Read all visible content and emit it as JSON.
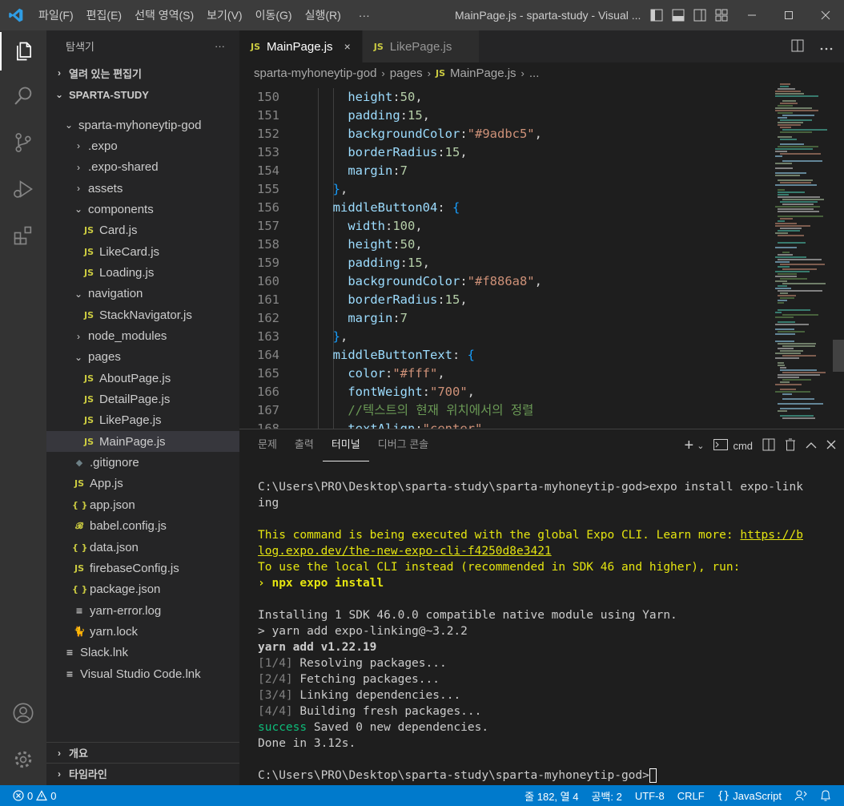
{
  "titlebar": {
    "menu": [
      "파일(F)",
      "편집(E)",
      "선택 영역(S)",
      "보기(V)",
      "이동(G)",
      "실행(R)",
      "···"
    ],
    "title": "MainPage.js - sparta-study - Visual ..."
  },
  "sidebar": {
    "header": "탐색기",
    "more": "···",
    "open_editors": "열려 있는 편집기",
    "workspace": "SPARTA-STUDY",
    "tree": [
      {
        "label": "sparta-myhoneytip-god",
        "type": "folder-open",
        "depth": 1
      },
      {
        "label": ".expo",
        "type": "folder",
        "depth": 2
      },
      {
        "label": ".expo-shared",
        "type": "folder",
        "depth": 2
      },
      {
        "label": "assets",
        "type": "folder",
        "depth": 2
      },
      {
        "label": "components",
        "type": "folder-open",
        "depth": 2
      },
      {
        "label": "Card.js",
        "type": "js",
        "depth": 3
      },
      {
        "label": "LikeCard.js",
        "type": "js",
        "depth": 3
      },
      {
        "label": "Loading.js",
        "type": "js",
        "depth": 3
      },
      {
        "label": "navigation",
        "type": "folder-open",
        "depth": 2
      },
      {
        "label": "StackNavigator.js",
        "type": "js",
        "depth": 3
      },
      {
        "label": "node_modules",
        "type": "folder",
        "depth": 2
      },
      {
        "label": "pages",
        "type": "folder-open",
        "depth": 2
      },
      {
        "label": "AboutPage.js",
        "type": "js",
        "depth": 3
      },
      {
        "label": "DetailPage.js",
        "type": "js",
        "depth": 3
      },
      {
        "label": "LikePage.js",
        "type": "js",
        "depth": 3
      },
      {
        "label": "MainPage.js",
        "type": "js",
        "depth": 3,
        "selected": true
      },
      {
        "label": ".gitignore",
        "type": "git",
        "depth": 2
      },
      {
        "label": "App.js",
        "type": "js",
        "depth": 2
      },
      {
        "label": "app.json",
        "type": "json",
        "depth": 2
      },
      {
        "label": "babel.config.js",
        "type": "babel",
        "depth": 2
      },
      {
        "label": "data.json",
        "type": "json",
        "depth": 2
      },
      {
        "label": "firebaseConfig.js",
        "type": "js",
        "depth": 2
      },
      {
        "label": "package.json",
        "type": "json",
        "depth": 2
      },
      {
        "label": "yarn-error.log",
        "type": "log",
        "depth": 2
      },
      {
        "label": "yarn.lock",
        "type": "yarn",
        "depth": 2
      },
      {
        "label": "Slack.lnk",
        "type": "lnk",
        "depth": 1
      },
      {
        "label": "Visual Studio Code.lnk",
        "type": "lnk",
        "depth": 1
      }
    ],
    "outline": "개요",
    "timeline": "타임라인"
  },
  "tabs": [
    {
      "label": "MainPage.js",
      "active": true,
      "badge": "JS",
      "close": "×"
    },
    {
      "label": "LikePage.js",
      "active": false,
      "badge": "JS"
    }
  ],
  "breadcrumb": {
    "parts": [
      "sparta-myhoneytip-god",
      "pages",
      "MainPage.js",
      "..."
    ],
    "badge": "JS"
  },
  "code": [
    {
      "n": "150",
      "indent": 2,
      "tokens": [
        [
          "prop",
          "height"
        ],
        [
          "pun",
          ":"
        ],
        [
          "num",
          "50"
        ],
        [
          "pun",
          ","
        ]
      ]
    },
    {
      "n": "151",
      "indent": 2,
      "tokens": [
        [
          "prop",
          "padding"
        ],
        [
          "pun",
          ":"
        ],
        [
          "num",
          "15"
        ],
        [
          "pun",
          ","
        ]
      ]
    },
    {
      "n": "152",
      "indent": 2,
      "tokens": [
        [
          "prop",
          "backgroundColor"
        ],
        [
          "pun",
          ":"
        ],
        [
          "str",
          "\"#9adbc5\""
        ],
        [
          "pun",
          ","
        ]
      ]
    },
    {
      "n": "153",
      "indent": 2,
      "tokens": [
        [
          "prop",
          "borderRadius"
        ],
        [
          "pun",
          ":"
        ],
        [
          "num",
          "15"
        ],
        [
          "pun",
          ","
        ]
      ]
    },
    {
      "n": "154",
      "indent": 2,
      "tokens": [
        [
          "prop",
          "margin"
        ],
        [
          "pun",
          ":"
        ],
        [
          "num",
          "7"
        ]
      ]
    },
    {
      "n": "155",
      "indent": 1,
      "tokens": [
        [
          "brace",
          "}"
        ],
        [
          "pun",
          ","
        ]
      ]
    },
    {
      "n": "156",
      "indent": 1,
      "tokens": [
        [
          "prop",
          "middleButton04"
        ],
        [
          "pun",
          ": "
        ],
        [
          "brace",
          "{"
        ]
      ]
    },
    {
      "n": "157",
      "indent": 2,
      "tokens": [
        [
          "prop",
          "width"
        ],
        [
          "pun",
          ":"
        ],
        [
          "num",
          "100"
        ],
        [
          "pun",
          ","
        ]
      ]
    },
    {
      "n": "158",
      "indent": 2,
      "tokens": [
        [
          "prop",
          "height"
        ],
        [
          "pun",
          ":"
        ],
        [
          "num",
          "50"
        ],
        [
          "pun",
          ","
        ]
      ]
    },
    {
      "n": "159",
      "indent": 2,
      "tokens": [
        [
          "prop",
          "padding"
        ],
        [
          "pun",
          ":"
        ],
        [
          "num",
          "15"
        ],
        [
          "pun",
          ","
        ]
      ]
    },
    {
      "n": "160",
      "indent": 2,
      "tokens": [
        [
          "prop",
          "backgroundColor"
        ],
        [
          "pun",
          ":"
        ],
        [
          "str",
          "\"#f886a8\""
        ],
        [
          "pun",
          ","
        ]
      ]
    },
    {
      "n": "161",
      "indent": 2,
      "tokens": [
        [
          "prop",
          "borderRadius"
        ],
        [
          "pun",
          ":"
        ],
        [
          "num",
          "15"
        ],
        [
          "pun",
          ","
        ]
      ]
    },
    {
      "n": "162",
      "indent": 2,
      "tokens": [
        [
          "prop",
          "margin"
        ],
        [
          "pun",
          ":"
        ],
        [
          "num",
          "7"
        ]
      ]
    },
    {
      "n": "163",
      "indent": 1,
      "tokens": [
        [
          "brace",
          "}"
        ],
        [
          "pun",
          ","
        ]
      ]
    },
    {
      "n": "164",
      "indent": 1,
      "tokens": [
        [
          "prop",
          "middleButtonText"
        ],
        [
          "pun",
          ": "
        ],
        [
          "brace",
          "{"
        ]
      ]
    },
    {
      "n": "165",
      "indent": 2,
      "tokens": [
        [
          "prop",
          "color"
        ],
        [
          "pun",
          ":"
        ],
        [
          "str",
          "\"#fff\""
        ],
        [
          "pun",
          ","
        ]
      ]
    },
    {
      "n": "166",
      "indent": 2,
      "tokens": [
        [
          "prop",
          "fontWeight"
        ],
        [
          "pun",
          ":"
        ],
        [
          "str",
          "\"700\""
        ],
        [
          "pun",
          ","
        ]
      ]
    },
    {
      "n": "167",
      "indent": 2,
      "tokens": [
        [
          "cmt",
          "//텍스트의 현재 위치에서의 정렬"
        ]
      ]
    },
    {
      "n": "168",
      "indent": 2,
      "tokens": [
        [
          "prop",
          "textAlign"
        ],
        [
          "pun",
          ":"
        ],
        [
          "str",
          "\"center\""
        ]
      ]
    }
  ],
  "panel": {
    "tabs": [
      "문제",
      "출력",
      "터미널",
      "디버그 콘솔"
    ],
    "active_tab": "터미널",
    "shell": "cmd",
    "terminal": [
      {
        "cls": "",
        "text": "C:\\Users\\PRO\\Desktop\\sparta-study\\sparta-myhoneytip-god>expo install expo-link"
      },
      {
        "cls": "",
        "text": "ing"
      },
      {
        "cls": "",
        "text": ""
      },
      {
        "cls": "yellow",
        "text": "This command is being executed with the global Expo CLI. Learn more: ",
        "link": "https://b"
      },
      {
        "cls": "yellow ul",
        "text": "log.expo.dev/the-new-expo-cli-f4250d8e3421"
      },
      {
        "cls": "yellow",
        "text": "To use the local CLI instead (recommended in SDK 46 and higher), run:"
      },
      {
        "cls": "yellow bold",
        "text": "› npx expo install"
      },
      {
        "cls": "",
        "text": ""
      },
      {
        "cls": "",
        "text": "Installing 1 SDK 46.0.0 compatible native module using Yarn."
      },
      {
        "cls": "",
        "text": "> yarn add expo-linking@~3.2.2"
      },
      {
        "cls": "bold",
        "text": "yarn add v1.22.19"
      },
      {
        "cls": "",
        "text": "[1/4] Resolving packages...",
        "prefix": "[1/4]"
      },
      {
        "cls": "",
        "text": "[2/4] Fetching packages...",
        "prefix": "[2/4]"
      },
      {
        "cls": "",
        "text": "[3/4] Linking dependencies...",
        "prefix": "[3/4]"
      },
      {
        "cls": "",
        "text": "[4/4] Building fresh packages...",
        "prefix": "[4/4]"
      },
      {
        "cls": "",
        "text": "success Saved 0 new dependencies.",
        "prefix": "success"
      },
      {
        "cls": "",
        "text": "Done in 3.12s."
      },
      {
        "cls": "",
        "text": ""
      },
      {
        "cls": "",
        "text": "C:\\Users\\PRO\\Desktop\\sparta-study\\sparta-myhoneytip-god>",
        "cursor": true
      }
    ]
  },
  "statusbar": {
    "errors": "0",
    "warnings": "0",
    "position": "줄 182, 열 4",
    "spaces": "공백: 2",
    "encoding": "UTF-8",
    "eol": "CRLF",
    "language": "JavaScript"
  },
  "colors": {
    "accent": "#007acc",
    "activity_bar": "#333333",
    "sidebar": "#252526",
    "editor": "#1e1e1e"
  }
}
